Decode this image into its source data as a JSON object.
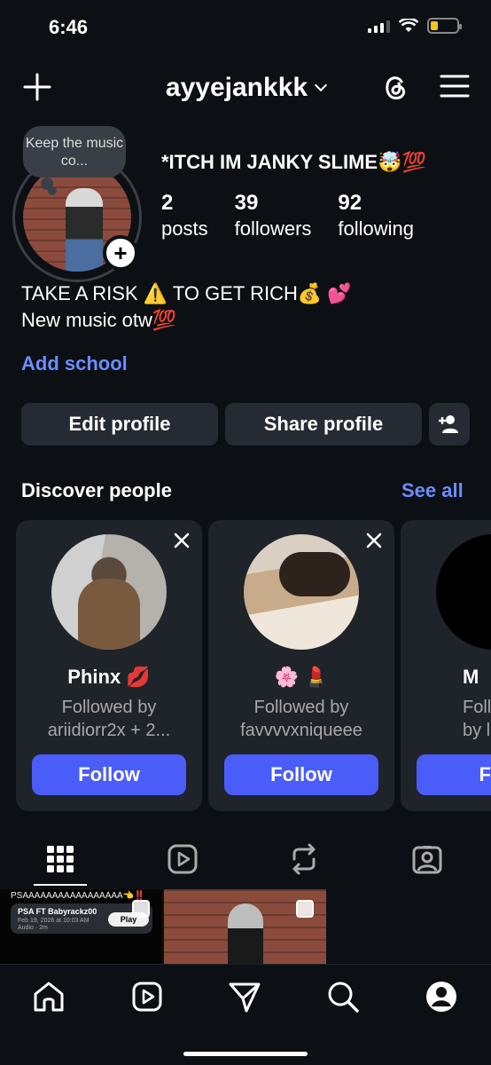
{
  "status_bar": {
    "time": "6:46"
  },
  "header": {
    "username": "ayyejankkk"
  },
  "note": {
    "text": "Keep the music co..."
  },
  "profile": {
    "display_name": "*ITCH IM JANKY SLIME🤯💯",
    "stats": [
      {
        "value": "2",
        "label": "posts"
      },
      {
        "value": "39",
        "label": "followers"
      },
      {
        "value": "92",
        "label": "following"
      }
    ],
    "bio_line1": "TAKE A RISK ⚠️ TO GET RICH💰 💕",
    "bio_line2": "New music otw💯",
    "add_school": "Add school"
  },
  "buttons": {
    "edit_profile": "Edit profile",
    "share_profile": "Share profile"
  },
  "discover": {
    "title": "Discover people",
    "see_all": "See all",
    "cards": [
      {
        "name": "Phinx 💋",
        "sub": "Followed by\nariidiorr2x + 2...",
        "follow": "Follow"
      },
      {
        "name": "🌸 💄",
        "sub": "Followed by\nfavvvvxniqueee",
        "follow": "Follow"
      },
      {
        "name": "M",
        "sub": "Follo\nby liilr",
        "follow": "Fol"
      }
    ]
  },
  "posts": [
    {
      "caption": "PSAAAAAAAAAAAAAAAAA👈‼️",
      "audio_title": "PSA FT Babyrackz00",
      "audio_date": "Feb 19, 2026 at 10:03 AM",
      "audio_len": "Audio · 2m",
      "play": "Play"
    }
  ],
  "colors": {
    "background": "#0c1014",
    "accent": "#4a5df9",
    "link": "#6c8dff",
    "button_bg": "#262b33",
    "card_bg": "#1f232a"
  },
  "icons": [
    "plus-icon",
    "chevron-down-icon",
    "threads-icon",
    "menu-icon",
    "add-person-icon",
    "close-icon",
    "grid-icon",
    "reels-icon",
    "repost-icon",
    "tagged-icon",
    "home-icon",
    "send-icon",
    "search-icon",
    "profile-icon"
  ]
}
